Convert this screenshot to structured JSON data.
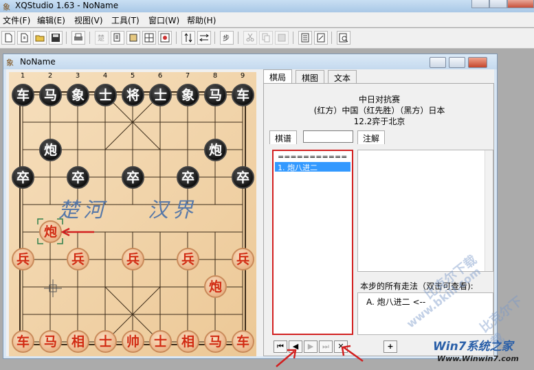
{
  "app": {
    "title": "XQStudio 1.63 - NoName",
    "logo_icon": "xiangqi-logo-icon"
  },
  "menu": [
    "文件(F)",
    "编辑(E)",
    "视图(V)",
    "工具(T)",
    "窗口(W)",
    "帮助(H)"
  ],
  "toolbar": [
    "new-icon",
    "open-icon",
    "folder-icon",
    "save-icon",
    "print-icon",
    "flip-icon",
    "copy-icon",
    "paste-icon",
    "board-edit-icon",
    "setup-icon",
    "swap-vertical-icon",
    "swap-horizontal-icon",
    "engine-icon",
    "cut-icon",
    "copy-disabled-icon",
    "paste-disabled-icon",
    "document-icon",
    "document-edit-icon",
    "print-preview-icon"
  ],
  "child": {
    "title": "NoName"
  },
  "board": {
    "file_numbers": [
      "1",
      "2",
      "3",
      "4",
      "5",
      "6",
      "7",
      "8",
      "9"
    ],
    "river_left": "楚河",
    "river_right": "汉界",
    "pieces": {
      "black_back": [
        "车",
        "马",
        "象",
        "士",
        "将",
        "士",
        "象",
        "马",
        "车"
      ],
      "black_cannons": [
        "炮",
        "炮"
      ],
      "black_pawns": [
        "卒",
        "卒",
        "卒",
        "卒",
        "卒"
      ],
      "red_cannon_moved": "炮",
      "red_cannon": "炮",
      "red_pawns": [
        "兵",
        "兵",
        "兵",
        "兵",
        "兵"
      ],
      "red_back": [
        "车",
        "马",
        "相",
        "士",
        "帅",
        "士",
        "相",
        "马",
        "车"
      ]
    }
  },
  "tabs": [
    "棋局",
    "棋图",
    "文本"
  ],
  "info": {
    "event": "中日对抗赛",
    "players": "(红方）中国（红先胜）（黑方）日本",
    "date_place": "12.2弈于北京"
  },
  "subtabs": {
    "record": "棋谱",
    "comment": "注解"
  },
  "move_list": {
    "header": "===========",
    "items": [
      "1. 炮八进二"
    ]
  },
  "all_moves": {
    "label": "本步的所有走法（双击可查看):",
    "items": [
      "A. 炮八进二 <--"
    ]
  },
  "nav_buttons": [
    "⏮",
    "◀",
    "▶",
    "⏭",
    "✕"
  ],
  "add_button": "+",
  "watermarks": {
    "brand": "Win7系统之家",
    "site": "Www.Winwin7.com",
    "diag1": "比克尔下载",
    "diag2": "比克尔下载",
    "url": "www.bkill.com"
  },
  "colors": {
    "red_piece_text": "#d12a12",
    "black_piece_bg": "#111111",
    "board": "#f2d6ae",
    "selection": "#3399ff",
    "highlight_border": "#d21f1f"
  }
}
